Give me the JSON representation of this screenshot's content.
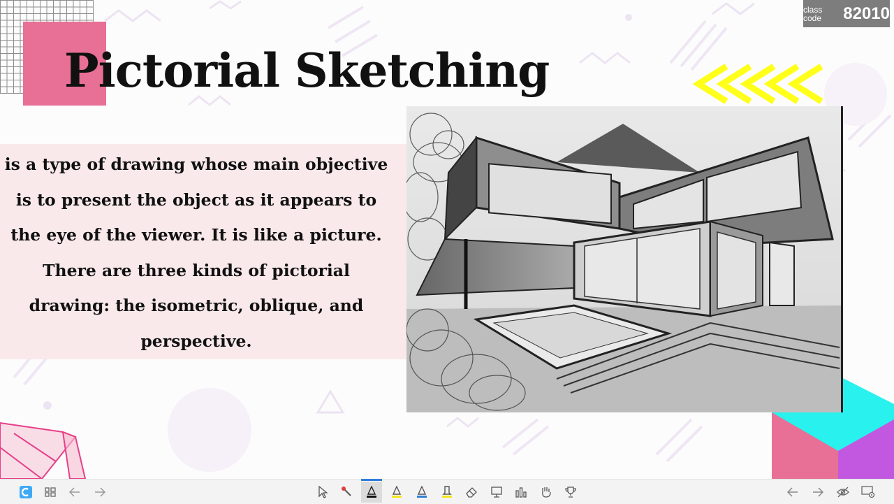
{
  "slide": {
    "title": "Pictorial Sketching",
    "definition": "is a type of drawing whose main objective is to present the object as it appears to the eye of the viewer. It is like a picture. There are three kinds of pictorial drawing: the isometric, oblique, and perspective.",
    "image_subject": "perspective-house-sketch"
  },
  "class_code": {
    "label": "class code",
    "value": "82010"
  },
  "colors": {
    "pink": "#e86f95",
    "yellow": "#ffff1a",
    "cyan": "#29f1ee",
    "purple": "#c258e0",
    "definition_bg": "#f9e9eb",
    "badge_bg": "#7d7d7d",
    "toolbar_bg": "#f3f3f3",
    "accent_blue": "#2f7ed8"
  },
  "toolbar": {
    "left": [
      "app-logo-icon",
      "grid-view-icon",
      "arrow-left-icon",
      "arrow-right-icon"
    ],
    "center": [
      "pointer-icon",
      "laser-pen-icon",
      "pen-black-icon",
      "highlighter-yellow-icon",
      "pen-blue-icon",
      "marker-yellow-icon",
      "eraser-icon",
      "whiteboard-icon",
      "poll-icon",
      "hand-raise-icon",
      "trophy-icon"
    ],
    "right": [
      "arrow-left-icon",
      "arrow-right-icon",
      "hide-icon",
      "settings-icon"
    ],
    "active_tool": "pen-black-icon"
  }
}
